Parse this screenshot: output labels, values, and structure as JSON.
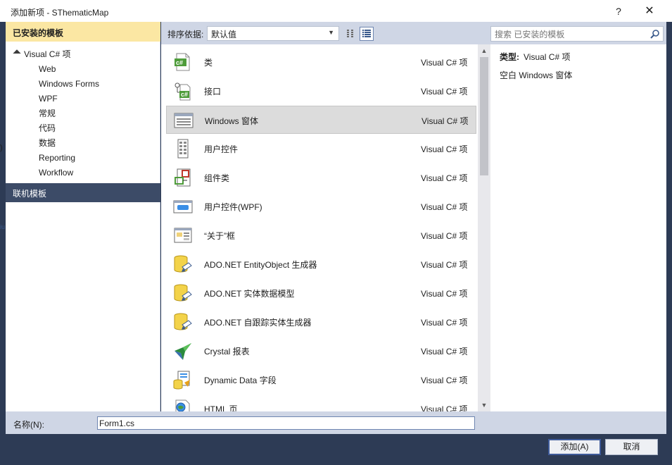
{
  "window": {
    "title": "添加新项 - SThematicMap",
    "help_label": "?",
    "close_label": "✕"
  },
  "left": {
    "installed_header": "已安装的模板",
    "root": {
      "label": "Visual C# 项"
    },
    "children": [
      "Web",
      "Windows Forms",
      "WPF",
      "常规",
      "代码",
      "数据",
      "Reporting",
      "Workflow"
    ],
    "online_header": "联机模板"
  },
  "toolbar": {
    "sort_label": "排序依据:",
    "sort_value": "默认值",
    "search_placeholder": "搜索 已安装的模板"
  },
  "items": [
    {
      "name": "类",
      "type": "Visual C# 项",
      "icon": "cs-class-icon"
    },
    {
      "name": "接口",
      "type": "Visual C# 项",
      "icon": "cs-interface-icon"
    },
    {
      "name": "Windows 窗体",
      "type": "Visual C# 项",
      "icon": "windows-form-icon",
      "selected": true
    },
    {
      "name": "用户控件",
      "type": "Visual C# 项",
      "icon": "user-control-icon"
    },
    {
      "name": "组件类",
      "type": "Visual C# 项",
      "icon": "component-class-icon"
    },
    {
      "name": "用户控件(WPF)",
      "type": "Visual C# 项",
      "icon": "wpf-user-control-icon"
    },
    {
      "name": "“关于”框",
      "type": "Visual C# 项",
      "icon": "about-box-icon"
    },
    {
      "name": "ADO.NET EntityObject 生成器",
      "type": "Visual C# 项",
      "icon": "database-icon"
    },
    {
      "name": "ADO.NET 实体数据模型",
      "type": "Visual C# 项",
      "icon": "database-icon"
    },
    {
      "name": "ADO.NET 自跟踪实体生成器",
      "type": "Visual C# 项",
      "icon": "database-icon"
    },
    {
      "name": "Crystal 报表",
      "type": "Visual C# 项",
      "icon": "crystal-report-icon"
    },
    {
      "name": "Dynamic Data 字段",
      "type": "Visual C# 项",
      "icon": "dynamic-data-icon"
    },
    {
      "name": "HTML 页",
      "type": "Visual C# 项",
      "icon": "html-page-icon"
    }
  ],
  "details": {
    "type_label": "类型:",
    "type_value": "Visual C# 项",
    "description": "空白 Windows 窗体"
  },
  "bottom": {
    "name_label": "名称(N):",
    "name_value": "Form1.cs",
    "add_label": "添加(A)",
    "cancel_label": "取消"
  },
  "colors": {
    "accent": "#3c4b67",
    "installed_header": "#fbe7a3",
    "frame": "#2d3b55",
    "toolbar": "#cfd6e5"
  }
}
